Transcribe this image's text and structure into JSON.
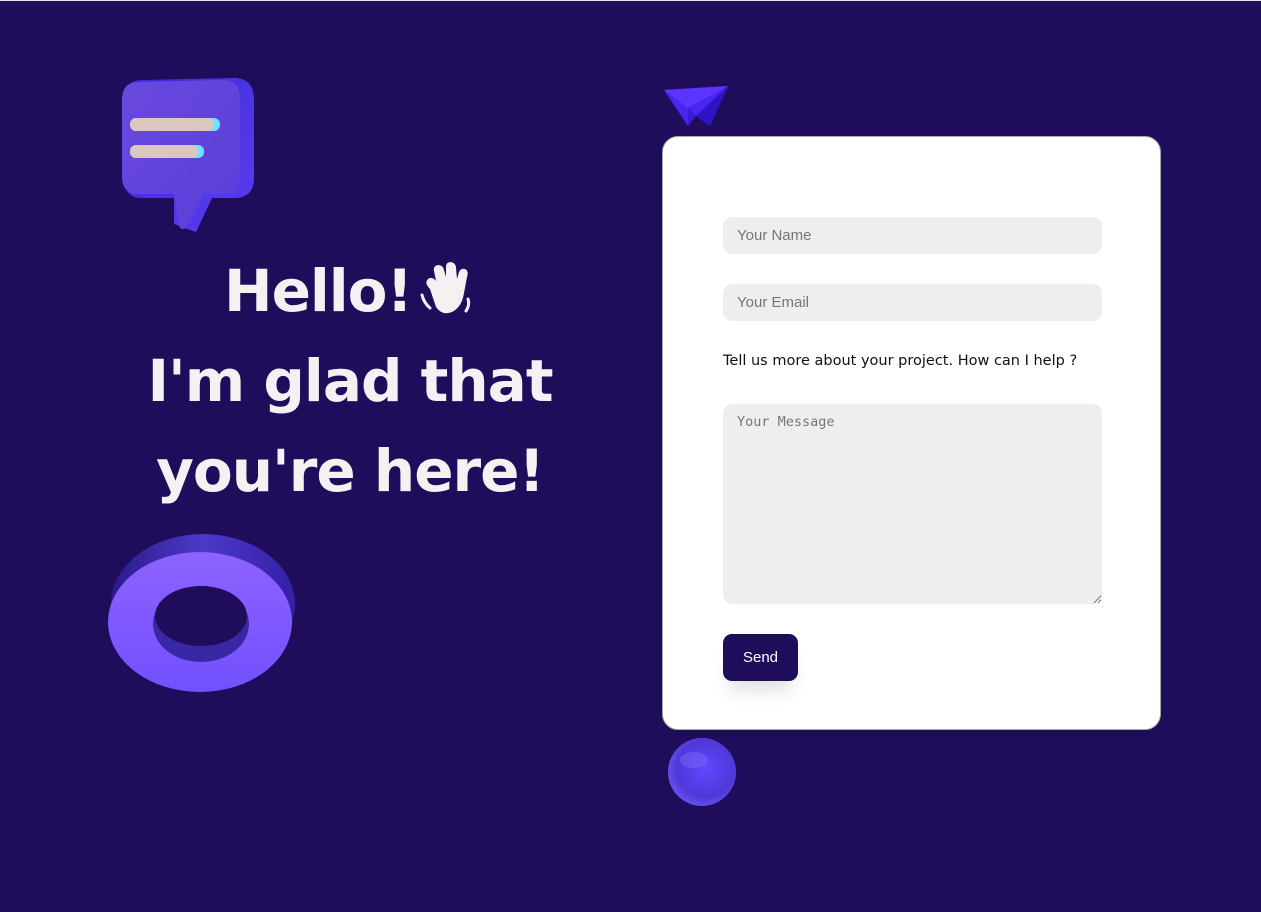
{
  "hero": {
    "line1": "Hello!",
    "line2": "I'm glad that",
    "line3": "you're here!",
    "emoji_icon": "waving-hand-icon"
  },
  "form": {
    "name_placeholder": "Your Name",
    "email_placeholder": "Your Email",
    "prompt": "Tell us more about your project. How can I help ?",
    "message_placeholder": "Your Message",
    "send_label": "Send"
  },
  "decorations": {
    "icons": [
      "chat-bubble-icon",
      "ring-icon",
      "paper-plane-icon",
      "sphere-icon"
    ]
  },
  "colors": {
    "background": "#1f0d5c",
    "accent": "#7b52ff",
    "accent_dark": "#3b29d6",
    "card": "#ffffff",
    "field": "#eeeeee",
    "hero_text": "#f6f0f2"
  }
}
